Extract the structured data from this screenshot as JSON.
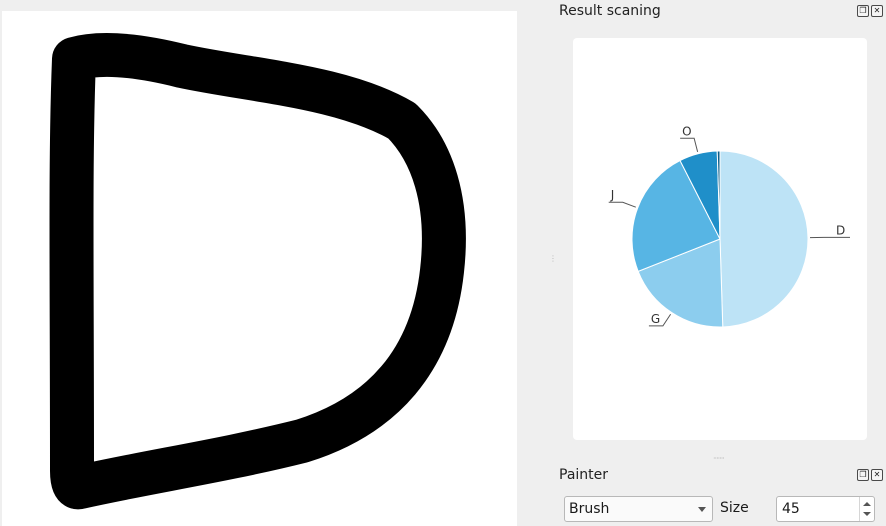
{
  "canvas": {
    "letter": "D"
  },
  "result_dock": {
    "title": "Result scaning",
    "buttons": [
      "float-icon",
      "close-icon"
    ]
  },
  "chart_data": {
    "type": "pie",
    "categories": [
      "D",
      "G",
      "J",
      "O",
      ""
    ],
    "values": [
      49.5,
      19.5,
      23.5,
      7.0,
      0.5
    ],
    "colors": [
      "#bde3f6",
      "#8ccdee",
      "#57b5e4",
      "#1f8fc9",
      "#0d5f8a"
    ],
    "title": ""
  },
  "painter_dock": {
    "title": "Painter",
    "tool_select": {
      "value": "Brush"
    },
    "size_label": "Size",
    "size_value": "45",
    "buttons": [
      "float-icon",
      "close-icon"
    ]
  }
}
